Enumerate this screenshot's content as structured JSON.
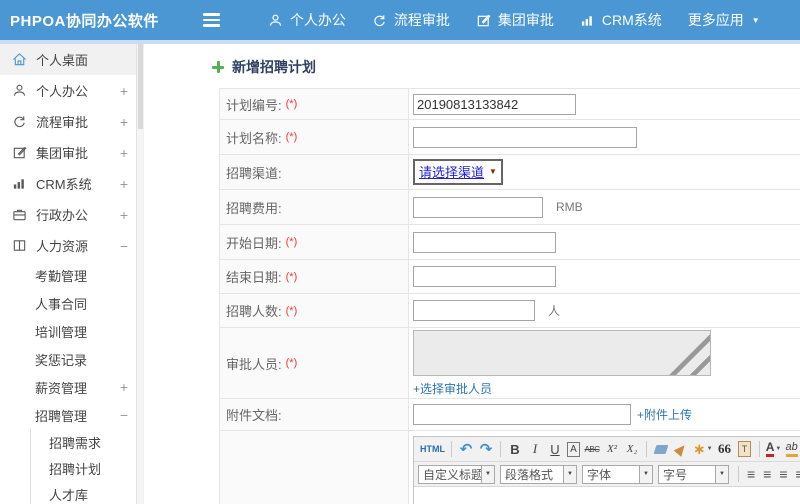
{
  "colors": {
    "topbar_blue": "#4a97d4",
    "subline_blue": "#c9ddf2",
    "link_blue": "#2d77b3",
    "required_red": "#ff3333",
    "title_navy": "#2f4261",
    "plus_green": "#55b055",
    "select_text_blue": "#2222cc",
    "select_caret_maroon": "#8b2500"
  },
  "icons": {
    "caret_down": "▼",
    "undo": "↶",
    "redo": "↷",
    "wand": "∗",
    "align_bars": "≡"
  },
  "topbar": {
    "logo": "PHPOA协同办公软件",
    "menu": [
      {
        "label": "个人办公",
        "icon": "user-icon"
      },
      {
        "label": "流程审批",
        "icon": "flow-icon"
      },
      {
        "label": "集团审批",
        "icon": "edit-icon"
      },
      {
        "label": "CRM系统",
        "icon": "chart-icon"
      },
      {
        "label": "更多应用",
        "icon": "caret-down-icon"
      }
    ]
  },
  "sidebar": {
    "items": [
      {
        "label": "个人桌面",
        "icon": "home",
        "level": 1,
        "expand": "",
        "active": true
      },
      {
        "label": "个人办公",
        "icon": "user",
        "level": 1,
        "expand": "+"
      },
      {
        "label": "流程审批",
        "icon": "flow",
        "level": 1,
        "expand": "+"
      },
      {
        "label": "集团审批",
        "icon": "edit",
        "level": 1,
        "expand": "+"
      },
      {
        "label": "CRM系统",
        "icon": "chart",
        "level": 1,
        "expand": "+"
      },
      {
        "label": "行政办公",
        "icon": "briefcase",
        "level": 1,
        "expand": "+"
      },
      {
        "label": "人力资源",
        "icon": "book",
        "level": 1,
        "expand": "−"
      },
      {
        "label": "考勤管理",
        "level": 2,
        "expand": ""
      },
      {
        "label": "人事合同",
        "level": 2,
        "expand": ""
      },
      {
        "label": "培训管理",
        "level": 2,
        "expand": ""
      },
      {
        "label": "奖惩记录",
        "level": 2,
        "expand": ""
      },
      {
        "label": "薪资管理",
        "level": 2,
        "expand": "+"
      },
      {
        "label": "招聘管理",
        "level": 2,
        "expand": "−"
      },
      {
        "label": "招聘需求",
        "level": 3,
        "expand": ""
      },
      {
        "label": "招聘计划",
        "level": 3,
        "expand": ""
      },
      {
        "label": "人才库",
        "level": 3,
        "expand": ""
      }
    ]
  },
  "main": {
    "title": "新增招聘计划",
    "form_rows": [
      {
        "label": "计划编号:",
        "star": "(*)",
        "value": "20190813133842"
      },
      {
        "label": "计划名称:",
        "star": "(*)",
        "value": ""
      },
      {
        "label": "招聘渠道:",
        "select": "请选择渠道"
      },
      {
        "label": "招聘费用:",
        "value": "",
        "suffix": "RMB"
      },
      {
        "label": "开始日期:",
        "star": "(*)",
        "value": ""
      },
      {
        "label": "结束日期:",
        "star": "(*)",
        "value": ""
      },
      {
        "label": "招聘人数:",
        "star": "(*)",
        "value": "",
        "suffix": "人"
      },
      {
        "label": "审批人员:",
        "star": "(*)",
        "link": "+选择审批人员"
      },
      {
        "label": "附件文档:",
        "value": "",
        "link": "+附件上传"
      }
    ],
    "editor": {
      "html_button": "HTML",
      "bold": "B",
      "italic": "I",
      "underline": "U",
      "font_border": "A",
      "strike": "ABC",
      "superscript": "X²",
      "subscript": "X₂",
      "quote": "66",
      "paste_text": "T",
      "font_color": "A",
      "highlight": "ab",
      "combos": [
        "自定义标题",
        "段落格式",
        "字体",
        "字号"
      ]
    }
  }
}
